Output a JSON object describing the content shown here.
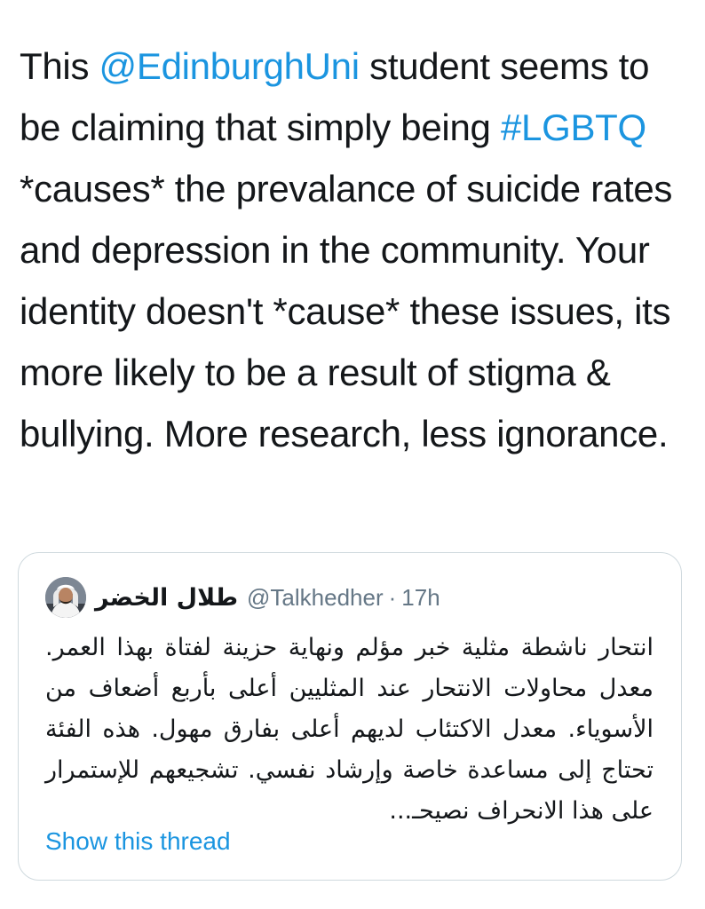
{
  "tweet": {
    "text_part1": "This ",
    "mention": "@EdinburghUni",
    "text_part2": " student seems to be claiming that simply being ",
    "hashtag": "#LGBTQ",
    "text_part3": " *causes* the prevalance of suicide rates and depression in the community. Your identity doesn't *cause* these issues, its more likely to be a result of stigma & bullying. More research, less ignorance."
  },
  "quote": {
    "display_name": "طلال الخضر",
    "handle": "@Talkhedher",
    "separator": "·",
    "time": "17h",
    "body": "انتحار ناشطة مثلية خبر مؤلم ونهاية حزينة لفتاة بهذا العمر. معدل محاولات الانتحار عند المثليين أعلى بأربع أضعاف من الأسوياء. معدل الاكتئاب لديهم أعلى بفارق مهول. هذه الفئة تحتاج إلى مساعدة خاصة وإرشاد نفسي. تشجيعهم للإستمرار على هذا الانحراف نصيحـ...",
    "show_thread": "Show this thread"
  },
  "colors": {
    "link": "#1b95e0",
    "text": "#14171a",
    "muted": "#657786",
    "card_border": "#cfd9de"
  },
  "icons": {
    "avatar": "avatar-photo"
  }
}
